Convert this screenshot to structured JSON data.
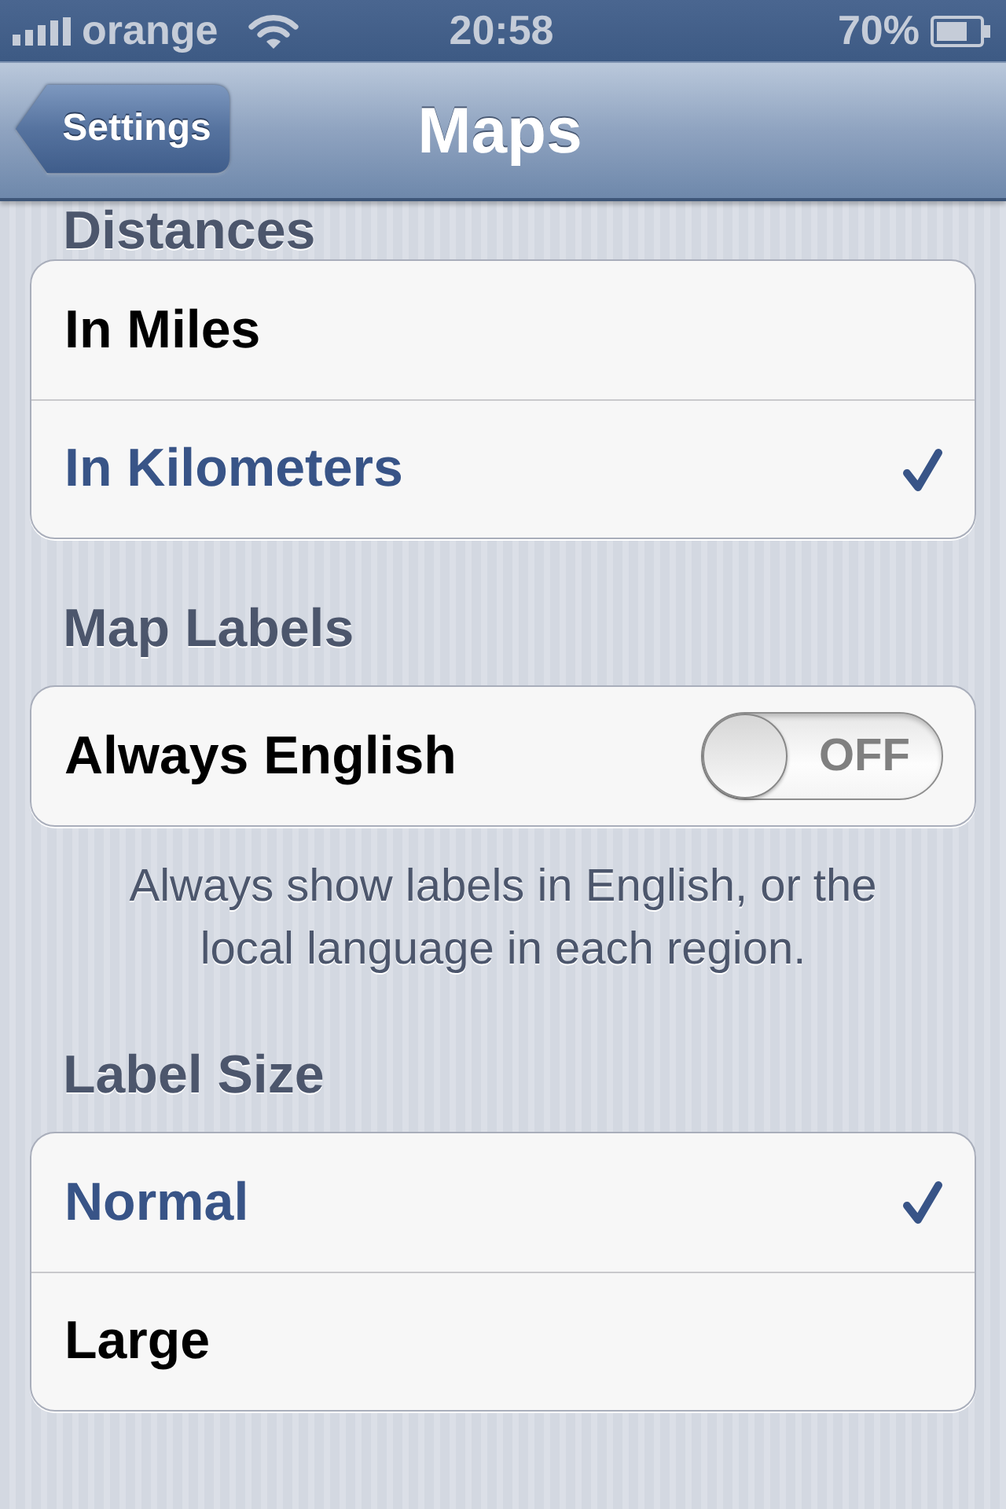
{
  "status_bar": {
    "carrier": "orange",
    "time": "20:58",
    "battery": "70%"
  },
  "nav_bar": {
    "back_button": "Settings",
    "title": "Maps"
  },
  "sections": [
    {
      "header": "Distances",
      "kind": "choice",
      "rows": [
        {
          "label": "In Miles",
          "selected": false
        },
        {
          "label": "In Kilometers",
          "selected": true
        }
      ]
    },
    {
      "header": "Map Labels",
      "kind": "switch",
      "rows": [
        {
          "label": "Always English",
          "on": false,
          "switch_text": "OFF"
        }
      ],
      "footer": "Always show labels in English, or the local language in each region."
    },
    {
      "header": "Label Size",
      "kind": "choice",
      "rows": [
        {
          "label": "Normal",
          "selected": true
        },
        {
          "label": "Large",
          "selected": false
        }
      ]
    }
  ]
}
